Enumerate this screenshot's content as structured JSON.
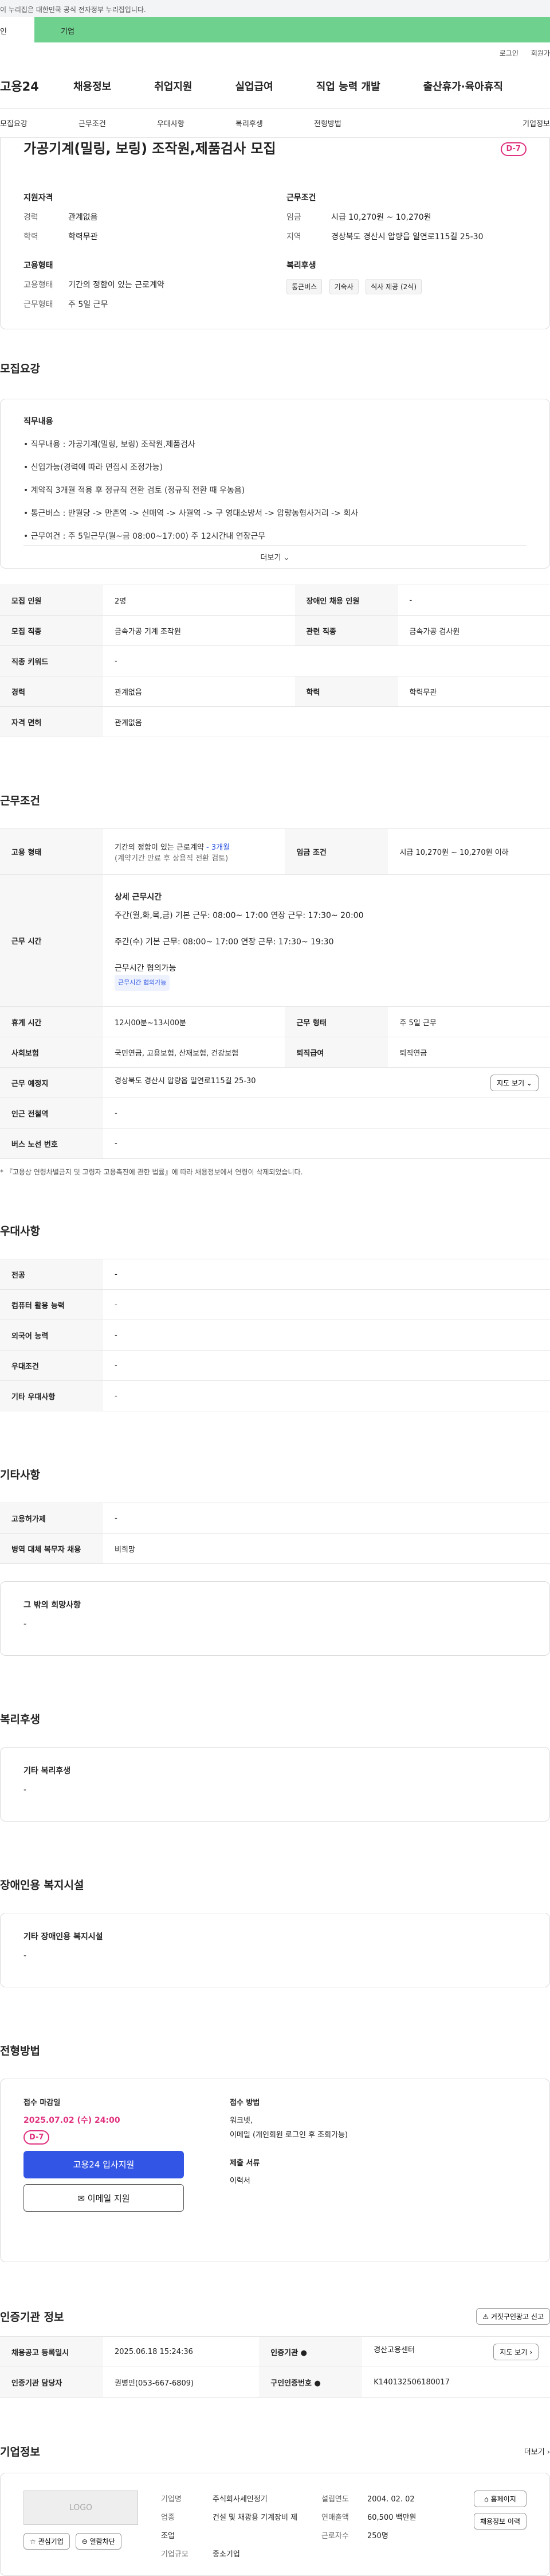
{
  "gov_banner": "이 누리집은 대한민국 공식 전자정부 누리집입니다.",
  "bl": {
    "left": "인",
    "right": "기업"
  },
  "util": {
    "login": "로그인",
    "join": "회원가"
  },
  "gnb": {
    "logo": "고용24",
    "menus": [
      "채용정보",
      "취업지원",
      "실업급여",
      "직업 능력 개발",
      "출산휴가·육아휴직"
    ]
  },
  "anchors": [
    "모집요강",
    "근무조건",
    "우대사항",
    "복리후생",
    "전형방법",
    "기업정보"
  ],
  "summary": {
    "title": "가공기계(밀링, 보링) 조작원,제품검사 모집",
    "dday": "D-7",
    "qual_h": "지원자격",
    "qual": [
      {
        "k": "경력",
        "v": "관계없음"
      },
      {
        "k": "학력",
        "v": "학력무관"
      }
    ],
    "cond_h": "근무조건",
    "cond": [
      {
        "k": "임금",
        "v": "시급 10,270원 ~ 10,270원"
      },
      {
        "k": "지역",
        "v": "경상북도 경산시 압량읍 일연로115길 25-30"
      }
    ],
    "emp_h": "고용형태",
    "emp": [
      {
        "k": "고용형태",
        "v": "기간의 정함이 있는 근로계약"
      },
      {
        "k": "근무형태",
        "v": "주 5일 근무"
      }
    ],
    "wel_h": "복리후생",
    "wel": [
      "통근버스",
      "기숙사",
      "식사 제공 (2식)"
    ]
  },
  "req": {
    "h": "모집요강",
    "sub": "직무내용",
    "items": [
      "• 직무내용 : 가공기계(밀링, 보링) 조작원,제품검사",
      "• 신입가능(경력에 따라 면접시 조정가능)",
      "• 계약직 3개월 적용 후 정규직 전환 검토 (정규직 전환 때 우농음)",
      "• 통근버스 : 반월당 -> 만촌역 -> 신매역 -> 사월역 -> 구 영대소방서 -> 압량농협사거리 -> 회사",
      "• 근무여건 : 주 5일근무(월~금 08:00~17:00) 주 12시간내 연장근무"
    ],
    "more": "더보기 ⌄",
    "rows": [
      [
        "모집 인원",
        "2명",
        "장애인 채용 인원",
        "-"
      ],
      [
        "모집 직종",
        "금속가공 기계 조작원",
        "관련 직종",
        "금속가공 검사원"
      ],
      [
        "직종 키워드",
        "-",
        "",
        ""
      ],
      [
        "경력",
        "관계없음",
        "학력",
        "학력무관"
      ],
      [
        "자격 면허",
        "관계없음",
        "",
        ""
      ]
    ]
  },
  "work": {
    "h": "근무조건",
    "emp_th": "고용 형태",
    "emp_v": "기간의 정함이 있는 근로계약",
    "emp_months": " - 3개월",
    "emp_v2": "(계약기간 만료 후 상용직 전환 검토)",
    "pay_th": "임금 조건",
    "pay_v": "시급 10,270원 ~ 10,270원 이하",
    "time_th": "근무 시간",
    "time_h": "상세 근무시간",
    "time1": "주간(월,화,목,금) 기본 근무: 08:00~ 17:00 연장 근무: 17:30~ 20:00",
    "time2": "주간(수) 기본 근무: 08:00~ 17:00 연장 근무: 17:30~ 19:30",
    "time3": "근무시간 협의가능",
    "time_tag": "근무시간 협의가능",
    "rows": [
      [
        "휴게 시간",
        "12시00분~13시00분",
        "근무 형태",
        "주 5일 근무"
      ],
      [
        "사회보험",
        "국민연금, 고용보험, 산재보험, 건강보험",
        "퇴직급여",
        "퇴직연금"
      ]
    ],
    "loc_th": "근무 예정지",
    "loc_v": "경상북도 경산시 압량읍 일연로115길 25-30",
    "map_btn": "지도 보기 ⌄",
    "station_th": "인근 전철역",
    "station_v": "-",
    "bus_th": "버스 노선 번호",
    "bus_v": "-",
    "note": "* 『고용상 연령차별금지 및 고령자 고용촉진에 관한 법률』에 따라 채용정보에서 연령이 삭제되었습니다."
  },
  "pref": {
    "h": "우대사항",
    "rows": [
      [
        "전공",
        "-"
      ],
      [
        "컴퓨터 활용 능력",
        "-"
      ],
      [
        "외국어 능력",
        "-"
      ],
      [
        "우대조건",
        "-"
      ],
      [
        "기타 우대사항",
        "-"
      ]
    ]
  },
  "etc": {
    "h": "기타사항",
    "rows": [
      [
        "고용허가제",
        "-"
      ],
      [
        "병역 대체 복무자 채용",
        "비희망"
      ]
    ],
    "box_h": "그 밖의 희망사항",
    "box_v": "-"
  },
  "welfare": {
    "h": "복리후생",
    "box_h": "기타 복리후생",
    "box_v": "-"
  },
  "disab": {
    "h": "장애인용 복지시설",
    "box_h": "기타 장애인용 복지시설",
    "box_v": "-"
  },
  "proc": {
    "h": "전형방법",
    "deadline_l": "접수 마감일",
    "deadline": "2025.07.02 (수) 24:00",
    "dday": "D-7",
    "apply_btn": "고용24 입사지원",
    "email_btn": "✉ 이메일 지원",
    "method_l": "접수 방법",
    "method1": "워크넷,",
    "method2": "이메일 (개인회원 로그인 후 조회가능)",
    "docs_l": "제출 서류",
    "docs": "이력서"
  },
  "cert": {
    "h": "인증기관 정보",
    "report": "⚠ 거짓구인광고 신고",
    "rows": [
      [
        "채용공고 등록일시",
        "2025.06.18 15:24:36",
        "인증기관 ●",
        "경산고용센터"
      ],
      [
        "인증기관 담당자",
        "권병민(053-667-6809)",
        "구인인증번호 ●",
        "K140132506180017"
      ]
    ],
    "map_btn": "지도 보기 ›"
  },
  "corp": {
    "h": "기업정보",
    "more": "더보기 ›",
    "logo": "LOGO",
    "fav": "☆ 관심기업",
    "close": "⊖ 열람차단",
    "k1": "기업명",
    "v1": "주식회사세인정기",
    "k2": "업종",
    "v2": "건설 및 채광용 기계장비 제조업",
    "k3": "기업규모",
    "v3": "중소기업",
    "k4": "설립연도",
    "v4": "2004. 02. 02",
    "k5": "연매출액",
    "v5": "60,500 백만원",
    "k6": "근로자수",
    "v6": "250명",
    "home": "⌂ 홈페이지",
    "cmp": "채용정보 이력"
  }
}
